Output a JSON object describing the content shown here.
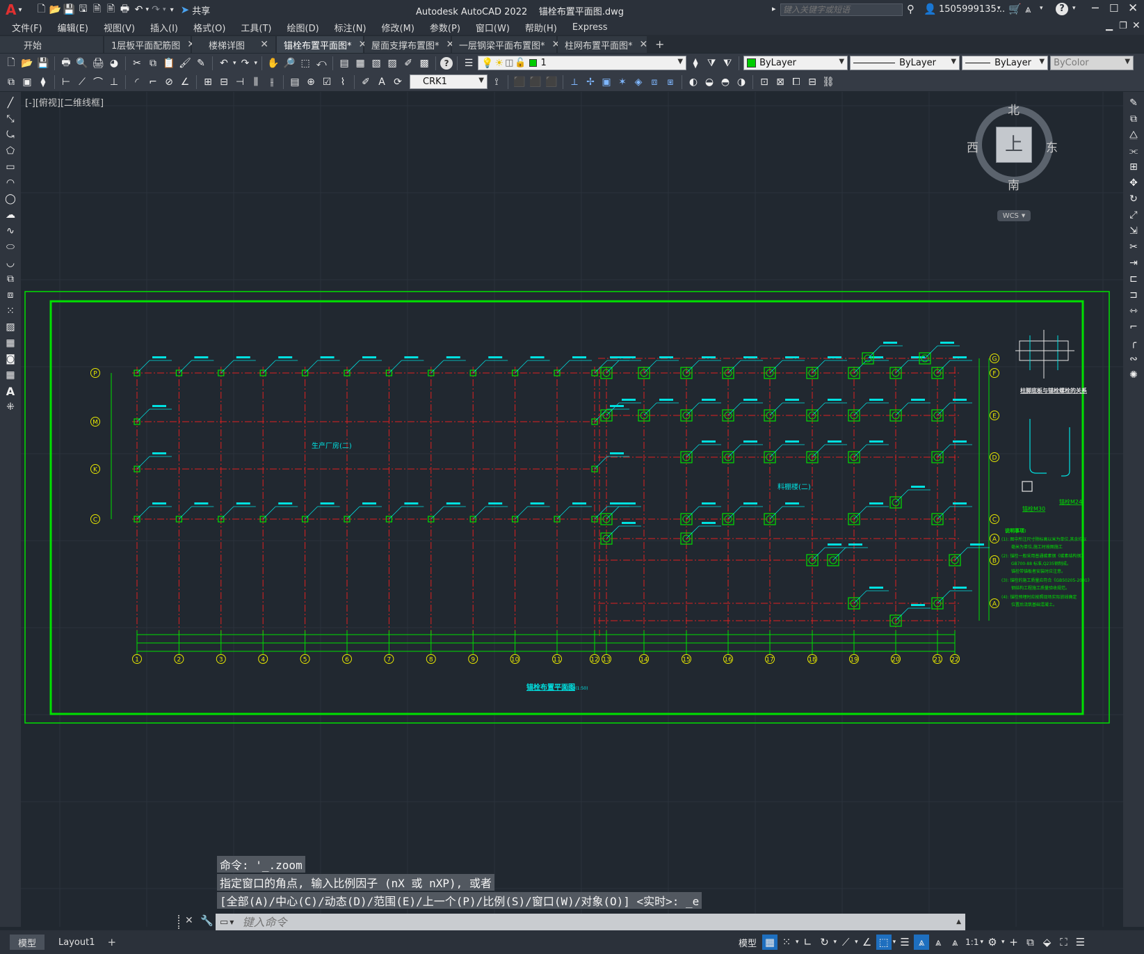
{
  "app": {
    "logo": "A",
    "share_label": "共享",
    "title": "Autodesk AutoCAD 2022    锚栓布置平面图.dwg",
    "search_placeholder": "键入关键字或短语",
    "user": "1505999135...",
    "help_icon": "?"
  },
  "menu": [
    "文件(F)",
    "编辑(E)",
    "视图(V)",
    "插入(I)",
    "格式(O)",
    "工具(T)",
    "绘图(D)",
    "标注(N)",
    "修改(M)",
    "参数(P)",
    "窗口(W)",
    "帮助(H)",
    "Express"
  ],
  "tabs": [
    {
      "label": "开始",
      "active": false,
      "closable": false
    },
    {
      "label": "1层板平面配筋图",
      "active": false,
      "closable": true
    },
    {
      "label": "楼梯详图",
      "active": false,
      "closable": true
    },
    {
      "label": "锚栓布置平面图*",
      "active": true,
      "closable": true
    },
    {
      "label": "屋面支撑布置图*",
      "active": false,
      "closable": true
    },
    {
      "label": "一层钢梁平面布置图*",
      "active": false,
      "closable": true
    },
    {
      "label": "柱网布置平面图*",
      "active": false,
      "closable": true
    }
  ],
  "tab_add": "+",
  "properties": {
    "layer_value": "1",
    "color_value": "ByLayer",
    "linetype_value": "ByLayer",
    "lineweight_value": "ByLayer",
    "plotstyle_value": "ByColor",
    "dimstyle_value": "CRK1"
  },
  "view_label": "[-][俯视][二维线框]",
  "viewcube": {
    "north": "北",
    "south": "南",
    "east": "东",
    "west": "西",
    "top": "上",
    "wcs": "WCS"
  },
  "drawing": {
    "title": "锚栓布置平面图",
    "scale_note": "1:150(1:50)",
    "zone_left": "生产厂房(二)",
    "zone_right": "料棚楼(二)",
    "x_axes": [
      "1",
      "2",
      "3",
      "4",
      "5",
      "6",
      "7",
      "8",
      "9",
      "10",
      "11",
      "12",
      "13",
      "14",
      "15",
      "16",
      "17",
      "18",
      "19",
      "20",
      "21",
      "22"
    ],
    "y_axes_left": [
      "P",
      "M",
      "K",
      "C"
    ],
    "y_axes_right": [
      "G",
      "F",
      "E",
      "D",
      "C",
      "A",
      "B",
      "A"
    ],
    "detail_title": "柱脚底板与锚栓螺栓的关系",
    "detail_labels": [
      "锚栓M30",
      "锚栓M24"
    ],
    "notes_title": "说明事项:",
    "notes": [
      "(1): 图中所注尺寸除标高以米为单位,其余均以",
      "毫米为单位,施工时按图施工",
      "(2): 锚栓一般采用普通碳素钢《碳素结构钢》",
      "GB700-88 标准,Q235钢制成。",
      "锚栓带锚板者安装时应注意。",
      "(3): 锚栓的施工质量应符合《GB50205-2001》",
      "钢结构工程施工质量验收规范。",
      "(4): 锚栓预埋时应按照现场实际放线确定",
      "位置后浇筑基础混凝土。"
    ]
  },
  "command": {
    "history": [
      "命令: '_.zoom",
      "指定窗口的角点, 输入比例因子 (nX 或 nXP), 或者",
      "[全部(A)/中心(C)/动态(D)/范围(E)/上一个(P)/比例(S)/窗口(W)/对象(O)] <实时>: _e"
    ],
    "placeholder": "键入命令"
  },
  "layouts": [
    {
      "label": "模型",
      "active": true
    },
    {
      "label": "Layout1",
      "active": false
    }
  ],
  "layout_add": "+",
  "status": {
    "model_label": "模型",
    "scale": "1:1"
  },
  "colors": {
    "frame_green": "#00e000",
    "axis_red": "#e02020",
    "annot_cyan": "#00e0e0",
    "bubble_yellow": "#e8e800",
    "background": "#212830"
  }
}
